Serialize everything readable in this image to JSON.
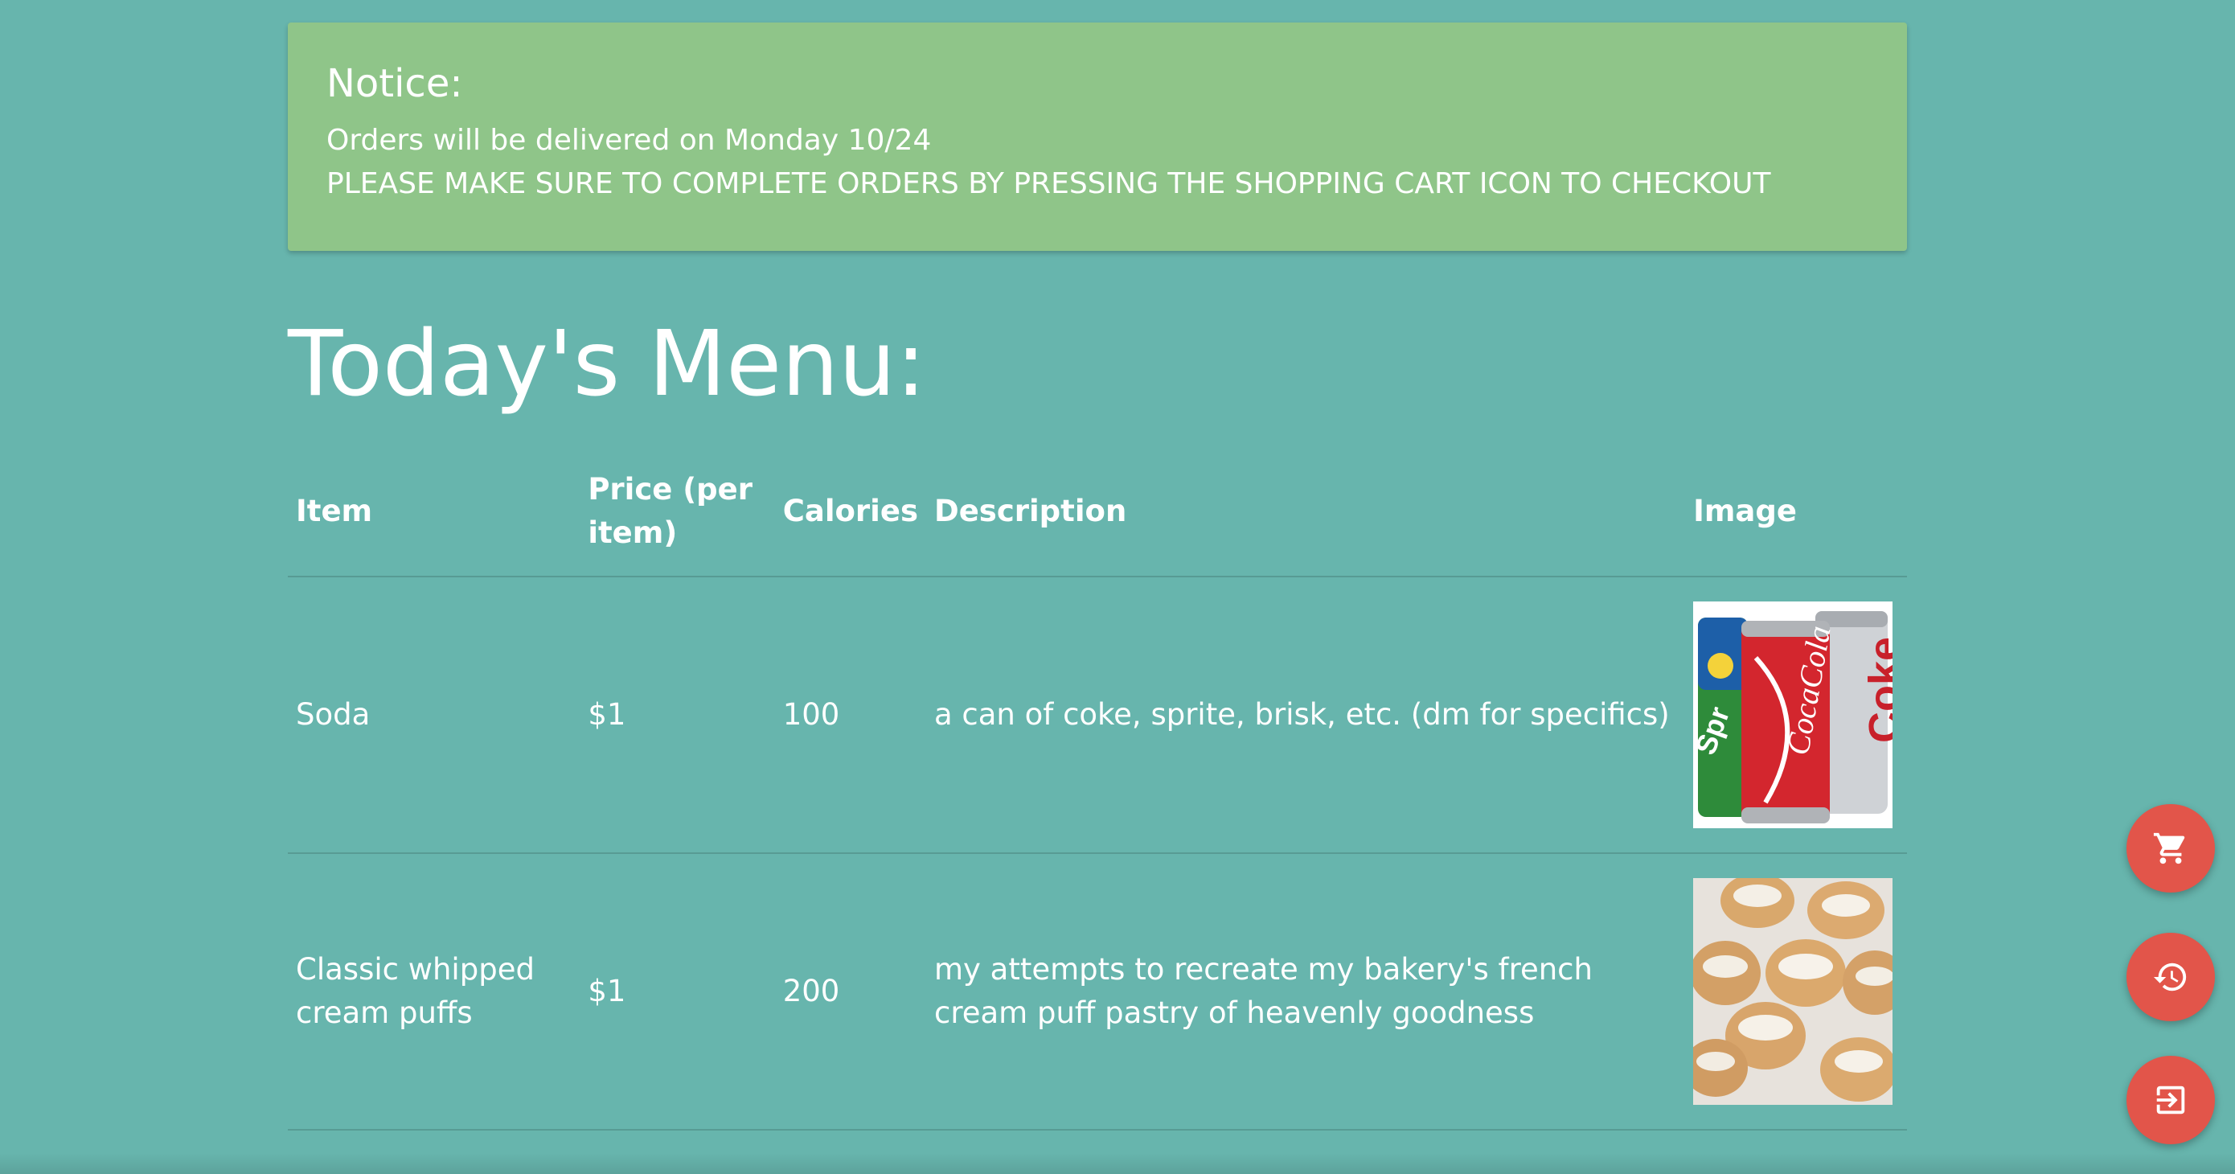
{
  "notice": {
    "title": "Notice:",
    "line1": "Orders will be delivered on Monday 10/24",
    "line2": "PLEASE MAKE SURE TO COMPLETE ORDERS BY PRESSING THE SHOPPING CART ICON TO CHECKOUT"
  },
  "menu": {
    "title": "Today's Menu:",
    "columns": [
      "Item",
      "Price (per item)",
      "Calories",
      "Description",
      "Image"
    ],
    "rows": [
      {
        "item": "Soda",
        "price": "$1",
        "calories": "100",
        "description": "a can of coke, sprite, brisk, etc. (dm for specifics)",
        "image": "soda-cans-image"
      },
      {
        "item": "Classic whipped cream puffs",
        "price": "$1",
        "calories": "200",
        "description": "my attempts to recreate my bakery's french cream puff pastry of heavenly goodness",
        "image": "cream-puffs-image"
      }
    ]
  },
  "fabs": [
    {
      "icon": "shopping-cart-icon"
    },
    {
      "icon": "history-icon"
    },
    {
      "icon": "logout-icon"
    }
  ],
  "colors": {
    "background": "#67b5ad",
    "notice": "#8fc589",
    "fab": "#e2554a"
  }
}
